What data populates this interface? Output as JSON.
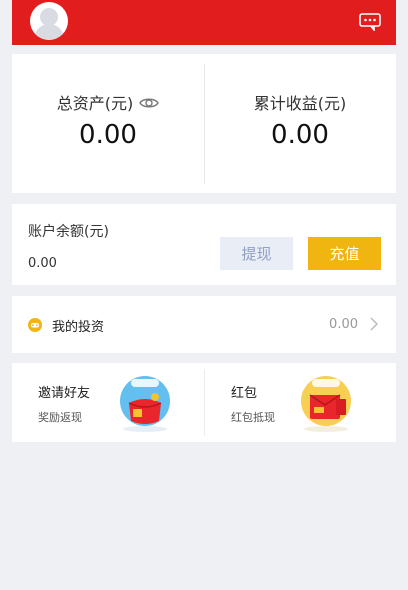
{
  "header": {
    "avatar": "avatar",
    "message_icon": "chat-bubble-icon",
    "background": "#e11d1d"
  },
  "assets": {
    "total_label": "总资产(元)",
    "total_value": "0.00",
    "visibility_icon": "eye-icon",
    "earnings_label": "累计收益(元)",
    "earnings_value": "0.00"
  },
  "balance": {
    "label": "账户余额(元)",
    "amount": "0.00",
    "withdraw_label": "提现",
    "recharge_label": "充值",
    "recharge_color": "#f1b512"
  },
  "investment": {
    "icon": "gamepad-icon",
    "label": "我的投资",
    "value": "0.00",
    "chevron": "chevron-right-icon"
  },
  "promos": [
    {
      "title": "邀请好友",
      "subtitle": "奖励返现",
      "art": "gift-bag-illustration"
    },
    {
      "title": "红包",
      "subtitle": "红包抵现",
      "art": "red-envelope-illustration"
    }
  ]
}
